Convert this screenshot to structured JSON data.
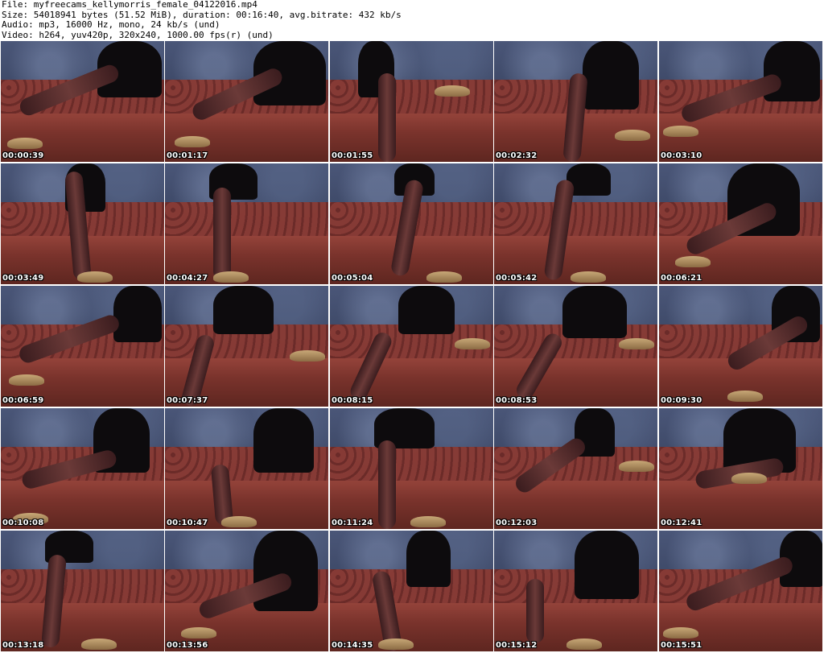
{
  "header": {
    "line1": "File: myfreecams_kellymorris_female_04122016.mp4",
    "line2": "Size: 54018941 bytes (51.52 MiB), duration: 00:16:40, avg.bitrate: 432 kb/s",
    "line3": "Audio: mp3, 16000 Hz, mono, 24 kb/s (und)",
    "line4": "Video: h264, yuv420p, 320x240, 1000.00 fps(r) (und)"
  },
  "thumbnails": [
    {
      "time": "00:00:39"
    },
    {
      "time": "00:01:17"
    },
    {
      "time": "00:01:55"
    },
    {
      "time": "00:02:32"
    },
    {
      "time": "00:03:10"
    },
    {
      "time": "00:03:49"
    },
    {
      "time": "00:04:27"
    },
    {
      "time": "00:05:04"
    },
    {
      "time": "00:05:42"
    },
    {
      "time": "00:06:21"
    },
    {
      "time": "00:06:59"
    },
    {
      "time": "00:07:37"
    },
    {
      "time": "00:08:15"
    },
    {
      "time": "00:08:53"
    },
    {
      "time": "00:09:30"
    },
    {
      "time": "00:10:08"
    },
    {
      "time": "00:10:47"
    },
    {
      "time": "00:11:24"
    },
    {
      "time": "00:12:03"
    },
    {
      "time": "00:12:41"
    },
    {
      "time": "00:13:18"
    },
    {
      "time": "00:13:56"
    },
    {
      "time": "00:14:35"
    },
    {
      "time": "00:15:12"
    },
    {
      "time": "00:15:51"
    }
  ]
}
